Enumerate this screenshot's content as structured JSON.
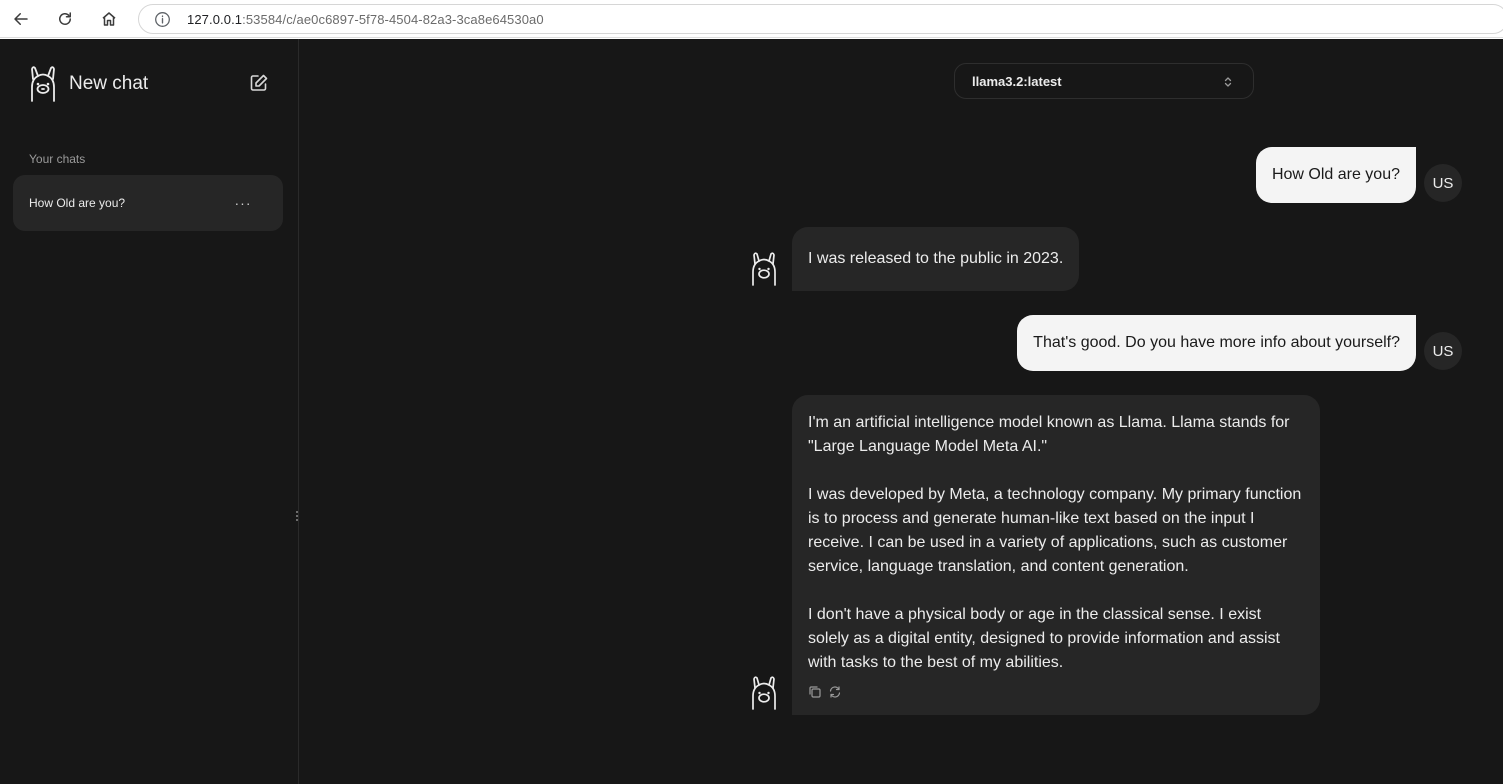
{
  "browser": {
    "url_host": "127.0.0.1",
    "url_rest": ":53584/c/ae0c6897-5f78-4504-82a3-3ca8e64530a0"
  },
  "sidebar": {
    "title": "New chat",
    "section_label": "Your chats",
    "chats": [
      {
        "label": "How Old are you?",
        "menu": "···"
      }
    ]
  },
  "header": {
    "model": "llama3.2:latest"
  },
  "messages": [
    {
      "role": "user",
      "avatar": "US",
      "text": "How Old are you?"
    },
    {
      "role": "assistant",
      "text": "I was released to the public in 2023."
    },
    {
      "role": "user",
      "avatar": "US",
      "text": "That's good. Do you have more info about yourself?"
    },
    {
      "role": "assistant",
      "paragraphs": [
        "I'm an artificial intelligence model known as Llama. Llama stands for \"Large Language Model Meta AI.\"",
        "I was developed by Meta, a technology company. My primary function is to process and generate human-like text based on the input I receive. I can be used in a variety of applications, such as customer service, language translation, and content generation.",
        "I don't have a physical body or age in the classical sense. I exist solely as a digital entity, designed to provide information and assist with tasks to the best of my abilities."
      ]
    }
  ],
  "icons": {
    "back": "arrow-left-icon",
    "reload": "reload-icon",
    "home": "home-icon",
    "site_info": "info-icon",
    "logo": "llama-logo-icon",
    "new_chat": "edit-icon",
    "copy": "copy-icon",
    "regenerate": "regenerate-icon"
  },
  "colors": {
    "background": "#171717",
    "surface": "#262626",
    "user_bubble": "#f4f4f4",
    "text": "#ececec"
  }
}
